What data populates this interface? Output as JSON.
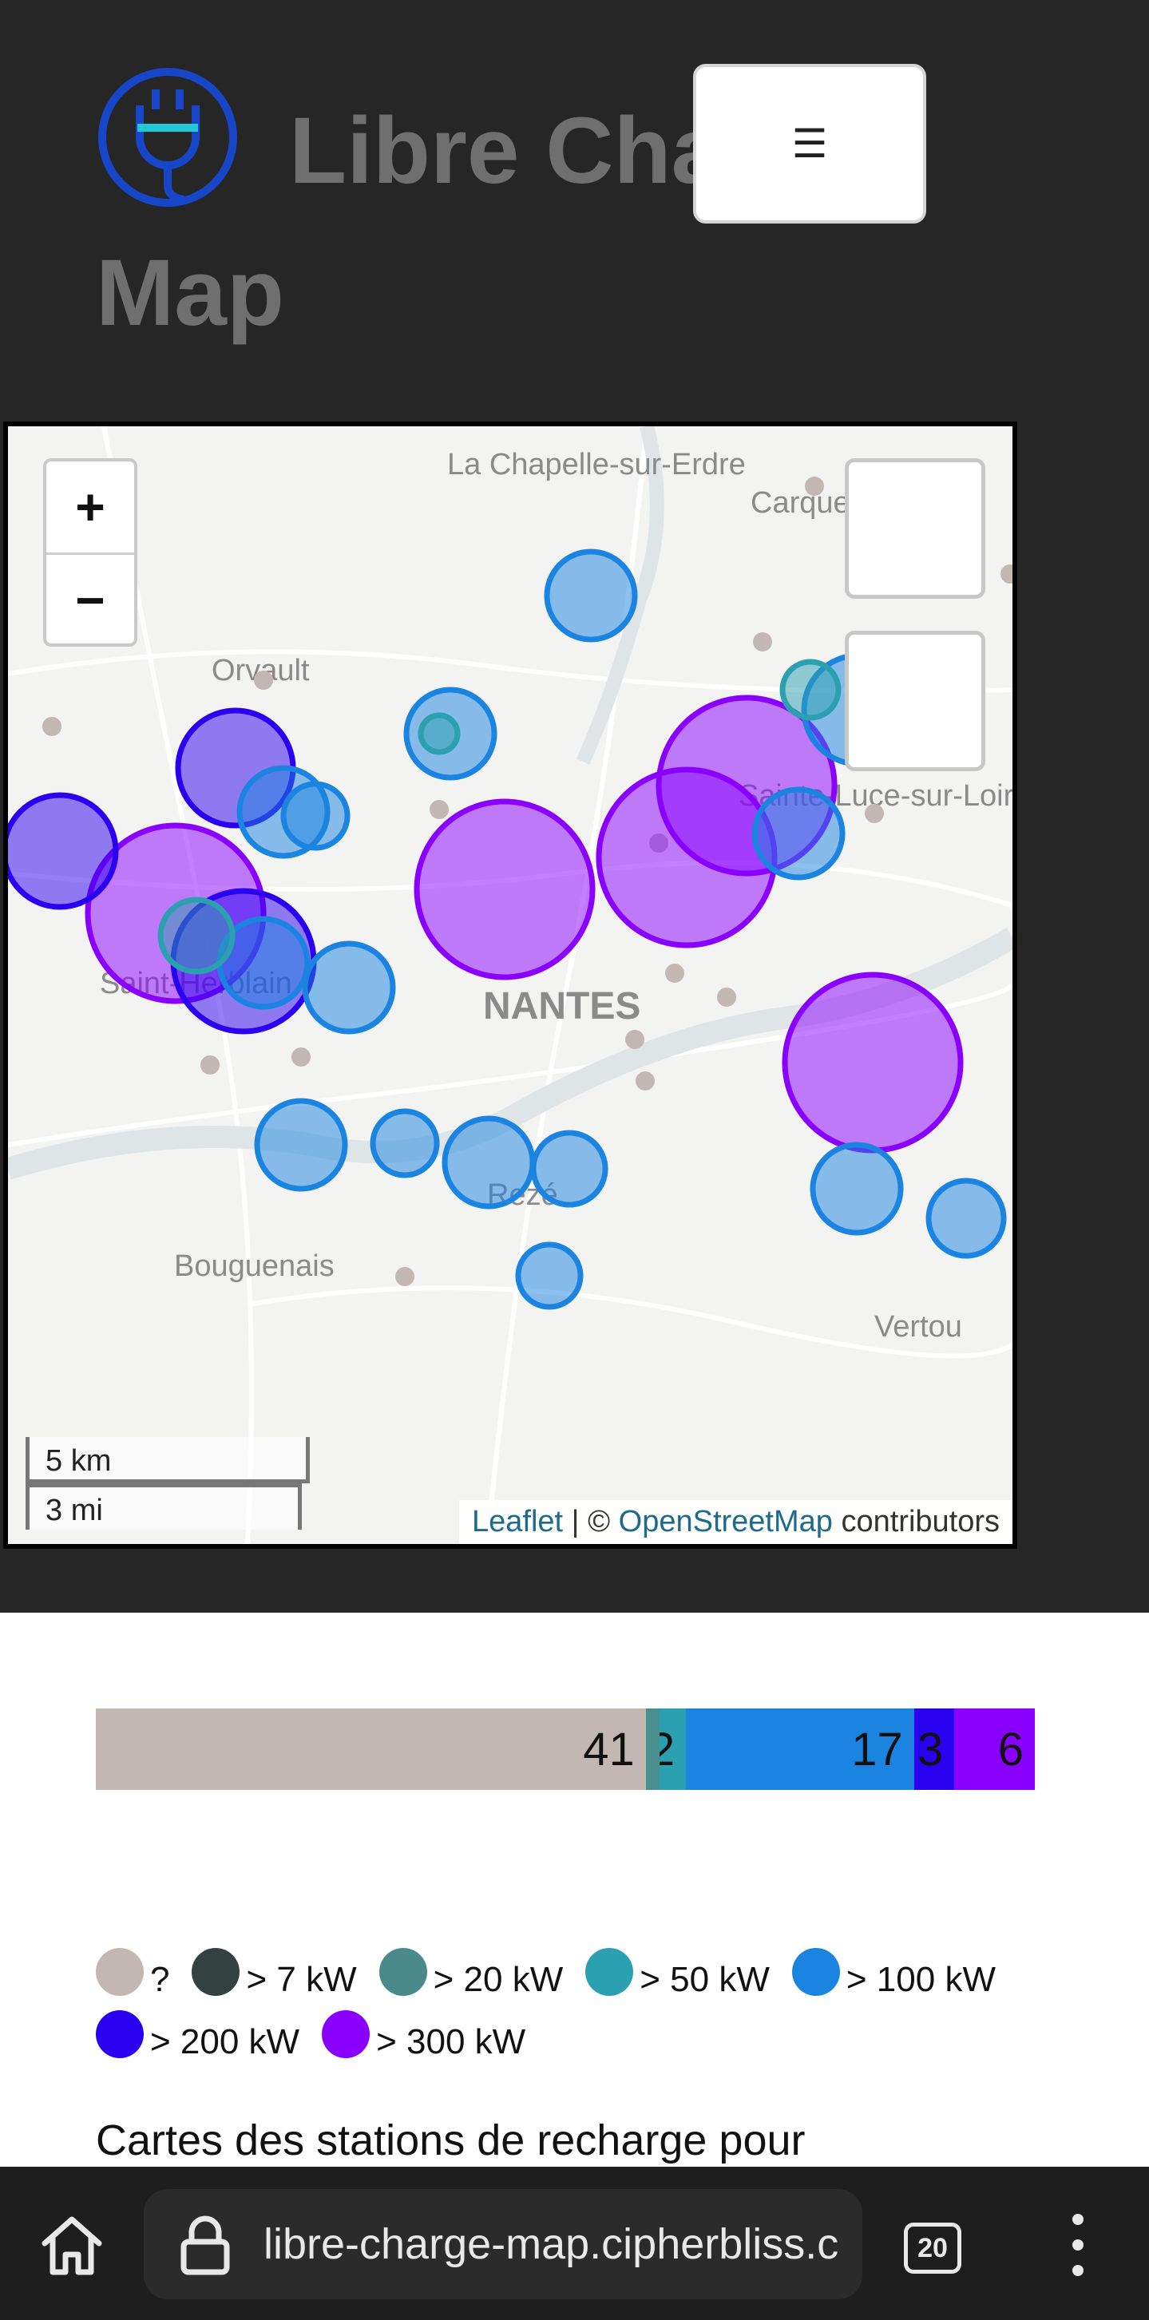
{
  "header": {
    "title": "Libre Charge Map",
    "menu_label": "☰"
  },
  "map": {
    "zoom_in_label": "+",
    "zoom_out_label": "−",
    "place_labels": [
      "La Chapelle-sur-Erdre",
      "Carquefou",
      "Orvault",
      "Sainte-Luce-sur-Loire",
      "Saint-Herblain",
      "NANTES",
      "Rezé",
      "Bouguenais",
      "Vertou"
    ],
    "scale_km": "5 km",
    "scale_mi": "3 mi",
    "attribution": {
      "leaflet": "Leaflet",
      "separator": " | © ",
      "osm": "OpenStreetMap",
      "suffix": " contributors"
    }
  },
  "stats_bar": {
    "segments": [
      {
        "label": "41",
        "value": 41,
        "color": "#c3b7b4"
      },
      {
        "label": "",
        "value": 1,
        "color": "#4a8f8f"
      },
      {
        "label": "2",
        "value": 2,
        "color": "#2aa0b0"
      },
      {
        "label": "17",
        "value": 17,
        "color": "#1a84e0"
      },
      {
        "label": "3",
        "value": 3,
        "color": "#2a00f0"
      },
      {
        "label": "6",
        "value": 6,
        "color": "#8a00ff"
      }
    ]
  },
  "legend": [
    {
      "label": "?",
      "color": "#c3b7b4"
    },
    {
      "label": "> 7 kW",
      "color": "#334241"
    },
    {
      "label": "> 20 kW",
      "color": "#4a8a8a"
    },
    {
      "label": "> 50 kW",
      "color": "#2aa0b0"
    },
    {
      "label": "> 100 kW",
      "color": "#1a84e0"
    },
    {
      "label": "> 200 kW",
      "color": "#2a00f0"
    },
    {
      "label": "> 300 kW",
      "color": "#8a00ff"
    }
  ],
  "description": "Cartes des stations de recharge pour",
  "browser": {
    "url": "libre-charge-map.cipherbliss.c",
    "tab_count": "20"
  }
}
